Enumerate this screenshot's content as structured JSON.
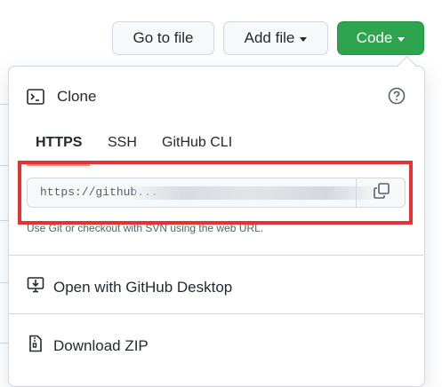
{
  "toolbar": {
    "goto_file_label": "Go to file",
    "add_file_label": "Add file",
    "code_label": "Code"
  },
  "clone": {
    "title": "Clone",
    "tabs": [
      "HTTPS",
      "SSH",
      "GitHub CLI"
    ],
    "url_value": "https://github...",
    "url_hint": "Use Git or checkout with SVN using the web URL."
  },
  "menu": {
    "open_desktop_label": "Open with GitHub Desktop",
    "download_zip_label": "Download ZIP"
  },
  "colors": {
    "accent_green": "#2da44e",
    "tab_underline": "#fd8c73",
    "highlight_red": "#e63131"
  },
  "icons": [
    "terminal-icon",
    "question-icon",
    "copy-icon",
    "desktop-download-icon",
    "file-zip-icon",
    "triangle-down-icon"
  ]
}
